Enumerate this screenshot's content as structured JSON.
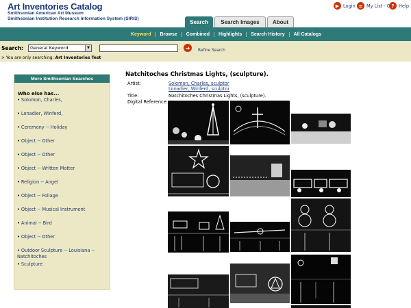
{
  "header": {
    "title": "Art Inventories Catalog",
    "subtitle1": "Smithsonian American Art Museum",
    "subtitle2": "Smithsonian Institution Research Information System (SIRIS)",
    "login": "Login",
    "mylist": "My List - 0",
    "help": "Help",
    "icons": {
      "login": "arrow-right-icon",
      "mylist": "list-icon",
      "help": "question-icon"
    }
  },
  "tabs": [
    {
      "label": "Search",
      "active": true
    },
    {
      "label": "Search Images",
      "active": false
    },
    {
      "label": "About",
      "active": false
    }
  ],
  "nav": [
    "Keyword",
    "Browse",
    "Combined",
    "Highlights",
    "Search History",
    "All Catalogs"
  ],
  "search": {
    "label": "Search:",
    "select_value": "General Keyword",
    "input_value": "",
    "refine": "Refine Search"
  },
  "only_searching": {
    "prefix": "> You are only searching:",
    "target": "Art Inventories Test"
  },
  "sidebar": {
    "heading": "More Smithsonian Searches",
    "who_else": "Who else has...",
    "items": [
      "Solomon, Charles,",
      "Lonadier, Winferd,",
      "Ceremony -- Holiday",
      "Object -- Other",
      "Object -- Other",
      "Object -- Written Matter",
      "Religion -- Angel",
      "Object -- Foliage",
      "Object -- Musical Instrument",
      "Animal -- Bird",
      "Object -- Other",
      "Outdoor Sculpture -- Louisiana -- Natchitoches",
      "Sculpture"
    ]
  },
  "record": {
    "title": "Natchitoches Christmas Lights, (sculpture).",
    "artist_label": "Artist:",
    "artists": [
      "Solomon, Charles, sculptor",
      "Lonadier, Winferd, sculptor"
    ],
    "title_label": "Title:",
    "title_value": "Natchitoches Christmas Lights, (sculpture).",
    "digital_label": "Digital Reference:"
  },
  "colors": {
    "teal": "#2e7a78",
    "beige": "#ece8c5",
    "navy": "#1a3a78",
    "accent_red": "#cc3300",
    "nav_selected": "#ffe35a"
  }
}
